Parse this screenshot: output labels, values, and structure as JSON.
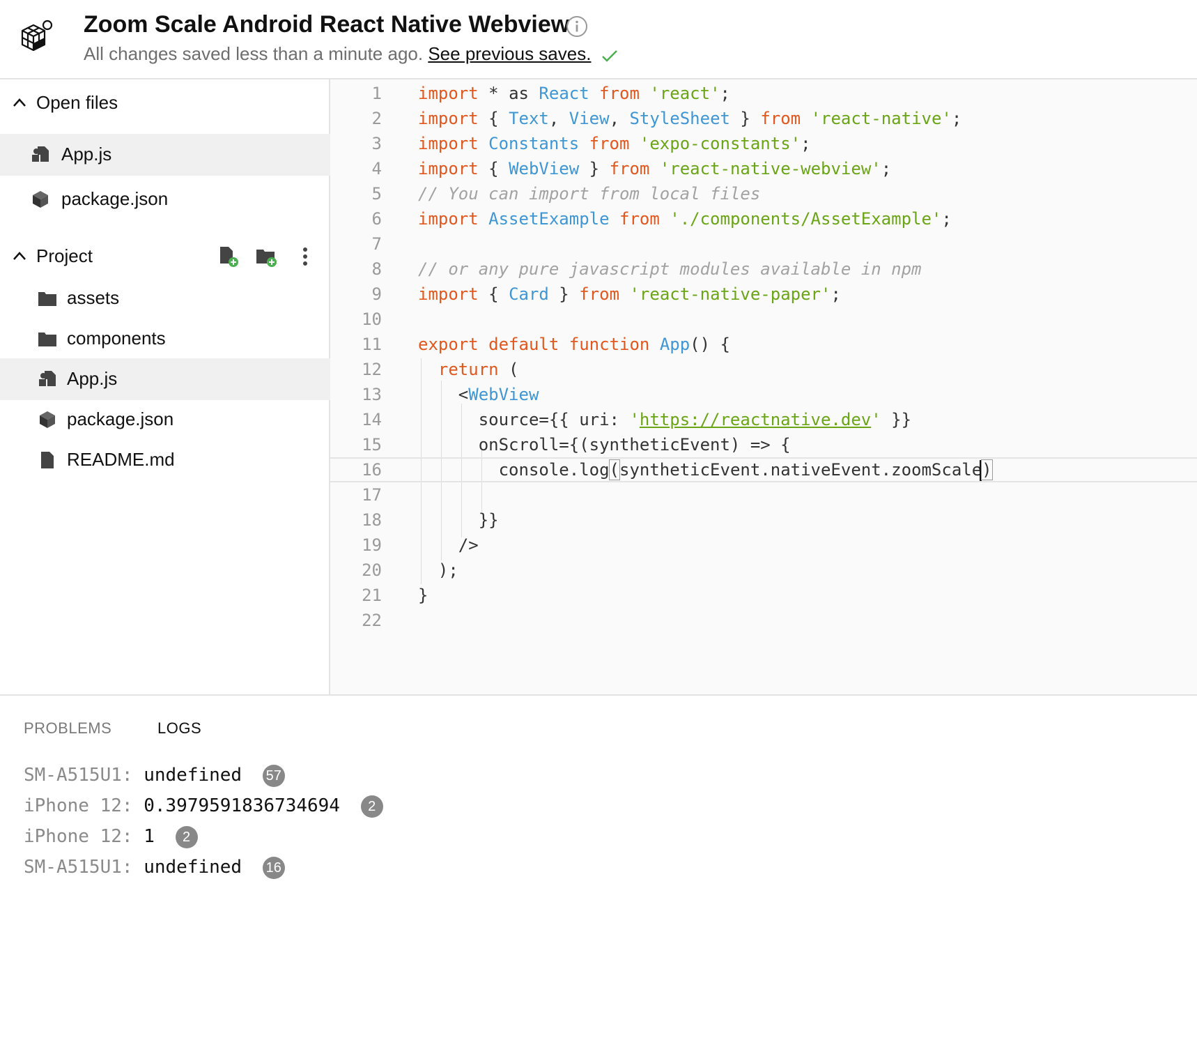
{
  "header": {
    "title": "Zoom Scale Android React Native Webview",
    "save_status": "All changes saved less than a minute ago.",
    "previous_saves_link": "See previous saves."
  },
  "sidebar": {
    "open_files": {
      "label": "Open files",
      "items": [
        {
          "label": "App.js",
          "icon": "js-file-icon",
          "active": true
        },
        {
          "label": "package.json",
          "icon": "package-icon",
          "active": false
        }
      ]
    },
    "project": {
      "label": "Project",
      "actions": [
        "new-file-icon",
        "new-folder-icon",
        "more-vertical-icon"
      ],
      "items": [
        {
          "label": "assets",
          "icon": "folder-icon",
          "active": false
        },
        {
          "label": "components",
          "icon": "folder-icon",
          "active": false
        },
        {
          "label": "App.js",
          "icon": "js-file-icon",
          "active": true
        },
        {
          "label": "package.json",
          "icon": "package-icon",
          "active": false
        },
        {
          "label": "README.md",
          "icon": "file-icon",
          "active": false
        }
      ]
    }
  },
  "editor": {
    "current_line": 16,
    "lines": [
      {
        "n": "1",
        "tokens": [
          [
            "kw",
            "import"
          ],
          [
            "tx",
            " * "
          ],
          [
            "tx",
            "as "
          ],
          [
            "id",
            "React"
          ],
          [
            "tx",
            " "
          ],
          [
            "kw",
            "from"
          ],
          [
            "tx",
            " "
          ],
          [
            "str",
            "'react'"
          ],
          [
            "tx",
            ";"
          ]
        ]
      },
      {
        "n": "2",
        "tokens": [
          [
            "kw",
            "import"
          ],
          [
            "tx",
            " { "
          ],
          [
            "id",
            "Text"
          ],
          [
            "tx",
            ", "
          ],
          [
            "id",
            "View"
          ],
          [
            "tx",
            ", "
          ],
          [
            "id",
            "StyleSheet"
          ],
          [
            "tx",
            " } "
          ],
          [
            "kw",
            "from"
          ],
          [
            "tx",
            " "
          ],
          [
            "str",
            "'react-native'"
          ],
          [
            "tx",
            ";"
          ]
        ]
      },
      {
        "n": "3",
        "tokens": [
          [
            "kw",
            "import"
          ],
          [
            "tx",
            " "
          ],
          [
            "id",
            "Constants"
          ],
          [
            "tx",
            " "
          ],
          [
            "kw",
            "from"
          ],
          [
            "tx",
            " "
          ],
          [
            "str",
            "'expo-constants'"
          ],
          [
            "tx",
            ";"
          ]
        ]
      },
      {
        "n": "4",
        "tokens": [
          [
            "kw",
            "import"
          ],
          [
            "tx",
            " { "
          ],
          [
            "id",
            "WebView"
          ],
          [
            "tx",
            " } "
          ],
          [
            "kw",
            "from"
          ],
          [
            "tx",
            " "
          ],
          [
            "str",
            "'react-native-webview'"
          ],
          [
            "tx",
            ";"
          ]
        ]
      },
      {
        "n": "5",
        "tokens": [
          [
            "cm",
            "// You can import from local files"
          ]
        ]
      },
      {
        "n": "6",
        "tokens": [
          [
            "kw",
            "import"
          ],
          [
            "tx",
            " "
          ],
          [
            "id",
            "AssetExample"
          ],
          [
            "tx",
            " "
          ],
          [
            "kw",
            "from"
          ],
          [
            "tx",
            " "
          ],
          [
            "str",
            "'./components/AssetExample'"
          ],
          [
            "tx",
            ";"
          ]
        ]
      },
      {
        "n": "7",
        "tokens": []
      },
      {
        "n": "8",
        "tokens": [
          [
            "cm",
            "// or any pure javascript modules available in npm"
          ]
        ]
      },
      {
        "n": "9",
        "tokens": [
          [
            "kw",
            "import"
          ],
          [
            "tx",
            " { "
          ],
          [
            "id",
            "Card"
          ],
          [
            "tx",
            " } "
          ],
          [
            "kw",
            "from"
          ],
          [
            "tx",
            " "
          ],
          [
            "str",
            "'react-native-paper'"
          ],
          [
            "tx",
            ";"
          ]
        ]
      },
      {
        "n": "10",
        "tokens": []
      },
      {
        "n": "11",
        "tokens": [
          [
            "kw",
            "export"
          ],
          [
            "tx",
            " "
          ],
          [
            "kw",
            "default"
          ],
          [
            "tx",
            " "
          ],
          [
            "kw",
            "function"
          ],
          [
            "tx",
            " "
          ],
          [
            "id",
            "App"
          ],
          [
            "tx",
            "() {"
          ]
        ]
      },
      {
        "n": "12",
        "tokens": [
          [
            "tx",
            "  "
          ],
          [
            "kw",
            "return"
          ],
          [
            "tx",
            " ("
          ]
        ]
      },
      {
        "n": "13",
        "tokens": [
          [
            "tx",
            "    <"
          ],
          [
            "id",
            "WebView"
          ]
        ]
      },
      {
        "n": "14",
        "tokens": [
          [
            "tx",
            "      source={{ uri: "
          ],
          [
            "str",
            "'"
          ],
          [
            "url",
            "https://reactnative.dev"
          ],
          [
            "str",
            "'"
          ],
          [
            "tx",
            " }}"
          ]
        ]
      },
      {
        "n": "15",
        "tokens": [
          [
            "tx",
            "      onScroll={(syntheticEvent) => {"
          ]
        ]
      },
      {
        "n": "16",
        "tokens": [
          [
            "tx",
            "        console.log"
          ],
          [
            "br",
            "("
          ],
          [
            "tx",
            "syntheticEvent.nativeEvent.zoomScale"
          ],
          [
            "cur",
            ""
          ],
          [
            "br",
            ")"
          ]
        ]
      },
      {
        "n": "17",
        "tokens": []
      },
      {
        "n": "18",
        "tokens": [
          [
            "tx",
            "      }}"
          ]
        ]
      },
      {
        "n": "19",
        "tokens": [
          [
            "tx",
            "    />"
          ]
        ]
      },
      {
        "n": "20",
        "tokens": [
          [
            "tx",
            "  );"
          ]
        ]
      },
      {
        "n": "21",
        "tokens": [
          [
            "tx",
            "}"
          ]
        ]
      },
      {
        "n": "22",
        "tokens": []
      }
    ]
  },
  "panel": {
    "tabs": {
      "problems": "PROBLEMS",
      "logs": "LOGS"
    },
    "active_tab": "LOGS",
    "logs": [
      {
        "device": "SM-A515U1:",
        "value": "undefined",
        "count": "57"
      },
      {
        "device": "iPhone 12:",
        "value": "0.3979591836734694",
        "count": "2"
      },
      {
        "device": "iPhone 12:",
        "value": "1",
        "count": "2"
      },
      {
        "device": "SM-A515U1:",
        "value": "undefined",
        "count": "16"
      }
    ]
  },
  "colors": {
    "keyword": "#e2571e",
    "identifier": "#3e96d4",
    "string": "#6aa516",
    "comment": "#a2a2a2",
    "success_check": "#4caf50",
    "add_badge": "#4caf50"
  }
}
